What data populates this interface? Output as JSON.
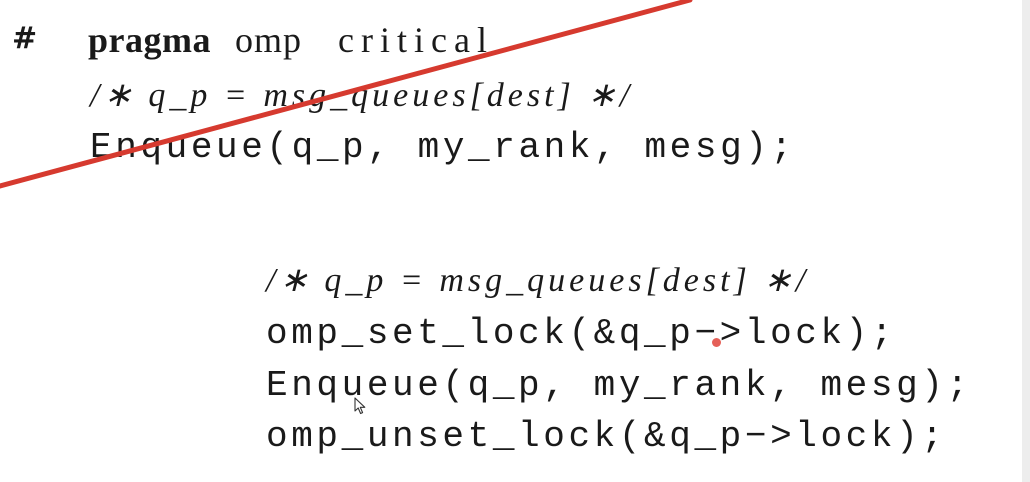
{
  "top_block": {
    "hash": "#",
    "pragma_keyword": "pragma",
    "pragma_omp": "omp",
    "pragma_critical": "critical",
    "comment": "/∗ q_p = msg_queues[dest] ∗/",
    "enqueue": "Enqueue(q_p, my_rank, mesg);"
  },
  "bottom_block": {
    "comment": "/∗ q_p = msg_queues[dest] ∗/",
    "set_lock": "omp_set_lock(&q_p−>lock);",
    "enqueue": "Enqueue(q_p, my_rank, mesg);",
    "unset_lock": "omp_unset_lock(&q_p−>lock);"
  },
  "annotation": {
    "strike_color": "#d63a2f",
    "dot_color": "#e0443b",
    "cursor_icon": "mouse-pointer-icon"
  }
}
